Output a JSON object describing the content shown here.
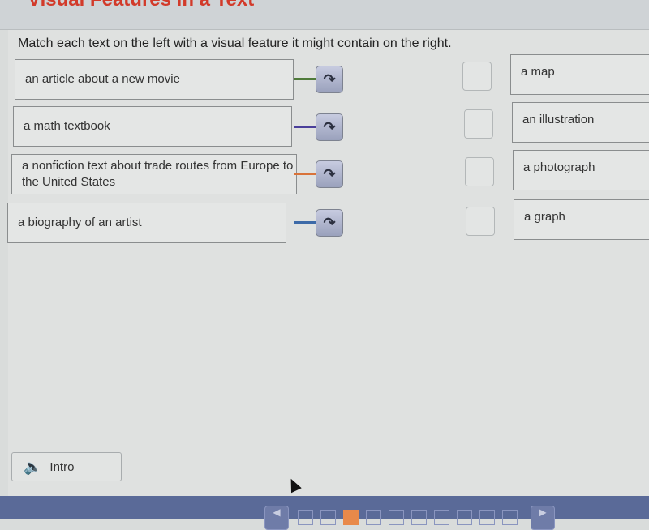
{
  "header": {
    "title": "Visual Features in a Text"
  },
  "instructions": "Match each text on the left with a visual feature it might contain on the right.",
  "left_items": [
    {
      "label": "an article about a new movie",
      "connector_color": "#4f7a3a"
    },
    {
      "label": "a math textbook",
      "connector_color": "#4a3f9a"
    },
    {
      "label": "a nonfiction text about trade routes from Europe to the United States",
      "connector_color": "#d9733a"
    },
    {
      "label": "a biography of an artist",
      "connector_color": "#3d6aa8"
    }
  ],
  "right_items": [
    {
      "label": "a map"
    },
    {
      "label": "an illustration"
    },
    {
      "label": "a photograph"
    },
    {
      "label": "a graph"
    }
  ],
  "intro_button": {
    "label": "Intro",
    "icon": "speaker-icon"
  },
  "pagination": {
    "total": 10,
    "current": 3,
    "accent": "#e8894a"
  }
}
